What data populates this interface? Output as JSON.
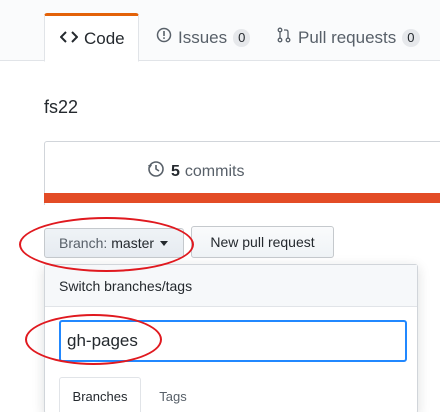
{
  "reponav": {
    "tabs": [
      {
        "label": "Code",
        "icon": "code-icon",
        "selected": true
      },
      {
        "label": "Issues",
        "icon": "issue-opened-icon",
        "count": "0"
      },
      {
        "label": "Pull requests",
        "icon": "git-pull-request-icon",
        "count": "0"
      }
    ]
  },
  "repo": {
    "description": "fs22",
    "commits_count": "5",
    "commits_label": "commits",
    "language_color": "#e34c26"
  },
  "branch_select": {
    "label": "Branch:",
    "value": "master"
  },
  "new_pr_button": "New pull request",
  "dropdown": {
    "title": "Switch branches/tags",
    "filter_value": "gh-pages",
    "tabs": [
      "Branches",
      "Tags"
    ]
  },
  "colors": {
    "accent_tab": "#e36209",
    "focus": "#2188ff",
    "annotation": "#e0191f"
  }
}
